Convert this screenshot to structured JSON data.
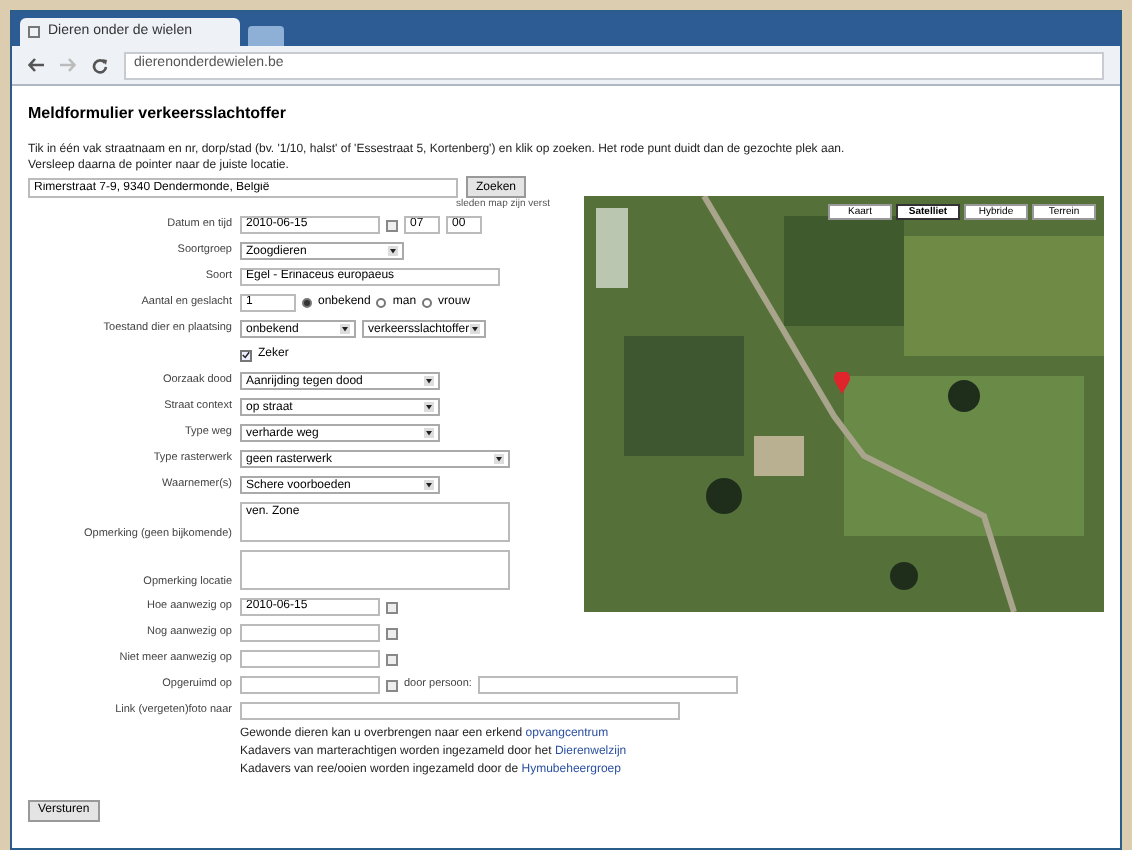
{
  "browser": {
    "tab_title": "Dieren onder de wielen",
    "url": "dierenonderdewielen.be"
  },
  "page": {
    "title": "Meldformulier verkeersslachtoffer",
    "intro": "Tik in één vak straatnaam en nr, dorp/stad (bv. '1/10, halst' of 'Essestraat 5, Kortenberg') en klik op zoeken. Het rode punt duidt dan de gezochte plek aan.",
    "intro_2": "Versleep daarna de pointer naar de juiste locatie.",
    "address": "Rimerstraat 7-9, 9340 Dendermonde, België",
    "search_button": "Zoeken",
    "map_hint": "sleden map zijn verst",
    "map_types": [
      {
        "label": "Kaart",
        "selected": false
      },
      {
        "label": "Satelliet",
        "selected": true
      },
      {
        "label": "Hybride",
        "selected": false
      },
      {
        "label": "Terrein",
        "selected": false
      }
    ]
  },
  "form": [
    {
      "kind": "datetime",
      "label": "Datum en tijd",
      "value": "2010-06-15",
      "hour": "07",
      "minute": "00"
    },
    {
      "kind": "select",
      "label": "Soortgroep",
      "value": "Zoogdieren"
    },
    {
      "kind": "text",
      "label": "Soort",
      "value": "Egel - Erinaceus europaeus"
    },
    {
      "kind": "count",
      "label": "Aantal en geslacht",
      "value": "1",
      "options": [
        {
          "label": "onbekend",
          "selected": true
        },
        {
          "label": "man",
          "selected": false
        },
        {
          "label": "vrouw",
          "selected": false
        }
      ]
    },
    {
      "kind": "double_select",
      "label": "Toestand dier en plaatsing",
      "value": "onbekend",
      "value_2": "verkeersslachtoffer"
    },
    {
      "kind": "check",
      "label": "Zeker",
      "checked": true
    },
    {
      "kind": "select",
      "label": "Oorzaak dood",
      "value": "Aanrijding tegen dood"
    },
    {
      "kind": "select",
      "label": "Straat context",
      "value": "op straat"
    },
    {
      "kind": "select",
      "label": "Type weg",
      "value": "verharde weg"
    },
    {
      "kind": "select",
      "label": "Type rasterwerk",
      "value": "geen rasterwerk"
    },
    {
      "kind": "select",
      "label": "Waarnemer(s)",
      "value": "Schere voorboeden"
    },
    {
      "kind": "textarea",
      "label": "Opmerking (geen bijkomende)",
      "value": "ven. Zone"
    },
    {
      "kind": "textarea",
      "label": "Opmerking locatie"
    },
    {
      "kind": "date",
      "label": "Hoe aanwezig op",
      "value": "2010-06-15"
    },
    {
      "kind": "date",
      "label": "Nog aanwezig op"
    },
    {
      "kind": "date",
      "label": "Niet meer aanwezig op"
    },
    {
      "kind": "date_person",
      "label": "Opgeruimd op",
      "person_label": "door persoon:"
    },
    {
      "kind": "wide",
      "label": "Link (vergeten)foto naar"
    }
  ],
  "notes": [
    "Gewonde dieren kan u overbrengen naar een erkend **opvangcentrum**",
    "Kadavers van marterachtigen worden ingezameld door het **Dierenwelzijn**",
    "Kadavers van ree/ooien worden ingezameld door de **Hymubeheergroep**"
  ],
  "submit": "Versturen"
}
